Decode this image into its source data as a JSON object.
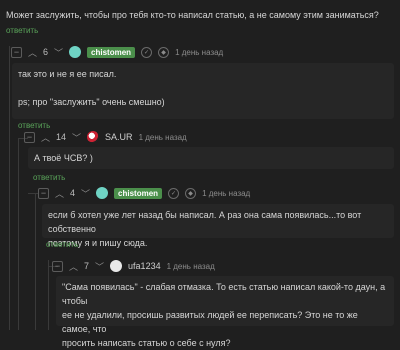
{
  "thread": {
    "top_comment": {
      "text": "Может заслужить, чтобы про тебя кто-то написал статью, а не самому этим заниматься?",
      "reply_label": "ответить"
    },
    "c1": {
      "score": "6",
      "user": "chistomen",
      "time": "1 день назад",
      "lines": [
        "так это и не я ее писал.",
        "ps; про \"заслужить\" очень смешно)"
      ],
      "reply_label": "ответить"
    },
    "c2": {
      "score": "14",
      "user": "SA.UR",
      "time": "1 день назад",
      "text": "А твоё ЧСВ? )",
      "reply_label": "ответить"
    },
    "c3": {
      "score": "4",
      "user": "chistomen",
      "time": "1 день назад",
      "lines": [
        "если б хотел уже лет назад бы написал. А раз она сама появилась...то вот собственно",
        "поэтому я и пишу сюда."
      ],
      "reply_label": "ответить"
    },
    "c4": {
      "score": "7",
      "user": "ufa1234",
      "time": "1 день назад",
      "lines": [
        "\"Сама появилась\" - слабая отмазка. То есть статью написал какой-то даун, а чтобы",
        "ее не удалили, просишь развитых людей ее переписать? Это не то же самое, что",
        "просить написать статью о себе с нуля?"
      ]
    }
  },
  "colors": {
    "accent_green": "#4b8f4b",
    "reply_green": "#5aa45a"
  }
}
